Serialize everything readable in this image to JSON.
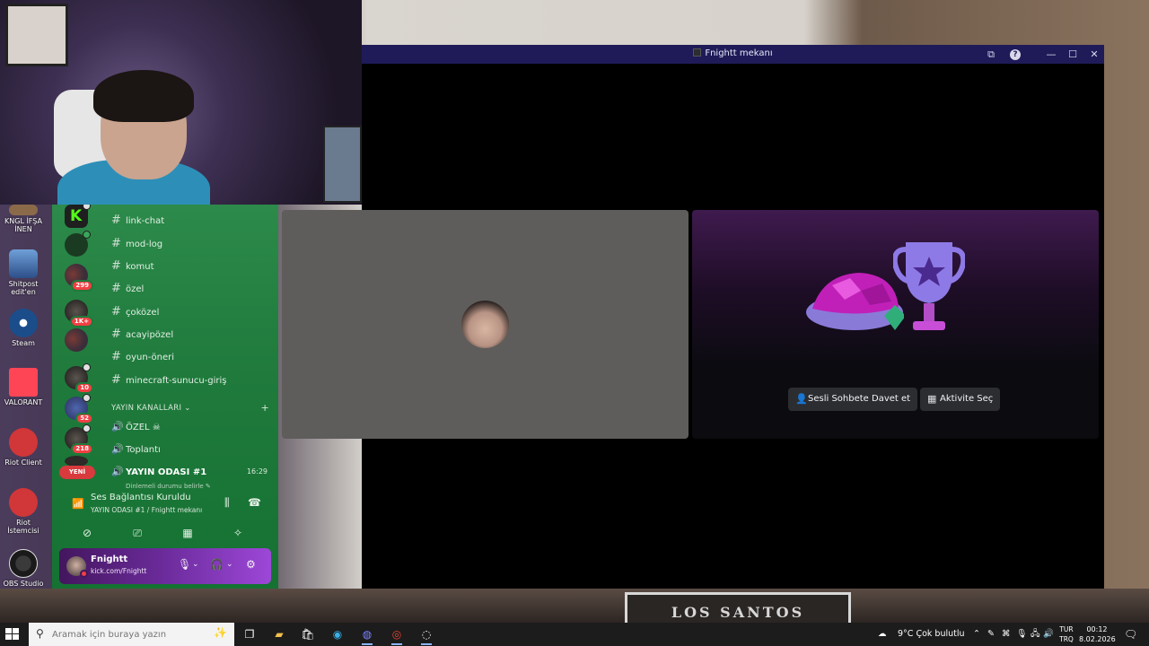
{
  "voice_window": {
    "title": "Fnightt mekanı",
    "buttons": {
      "invite": "Sesli Sohbete Davet et",
      "activity": "Aktivite Seç"
    }
  },
  "channels": {
    "text": [
      "link-chat",
      "mod-log",
      "komut",
      "özel",
      "çoközel",
      "acayipözel",
      "oyun-öneri",
      "minecraft-sunucu-giriş"
    ],
    "category": "YAYIN KANALLARI",
    "voice": [
      "ÖZEL ☠",
      "Toplantı"
    ],
    "active": {
      "name": "YAYIN ODASI #1",
      "time": "16:29",
      "sub": "Dinlemeli durumu belirle ✎"
    }
  },
  "servers": {
    "badges": [
      "299",
      "1K+",
      "10",
      "52",
      "218"
    ],
    "new_label": "YENİ"
  },
  "rtc": {
    "status": "Ses Bağlantısı Kuruldu",
    "location": "YAYIN ODASI #1 / Fnightt mekanı"
  },
  "user": {
    "name": "Fnightt",
    "status": "kick.com/Fnightt"
  },
  "desktop_icons": [
    "KNGL İFŞA İNEN",
    "Shitpost edit'en",
    "Steam",
    "VALORANT",
    "Riot Client",
    "Riot İstemcisi",
    "OBS Studio"
  ],
  "backdrop": {
    "shirt_text": "LOS SANTOS"
  },
  "taskbar": {
    "search_placeholder": "Aramak için buraya yazın",
    "weather": "9°C  Çok bulutlu",
    "lang_line1": "TUR",
    "lang_line2": "TRQ",
    "time": "00:12",
    "date": "8.02.2026"
  },
  "colors": {
    "discord_green": "#1f7a3c",
    "titlebar": "#1f1b59",
    "kick_green": "#53fc18",
    "badge_red": "#f23f43"
  }
}
